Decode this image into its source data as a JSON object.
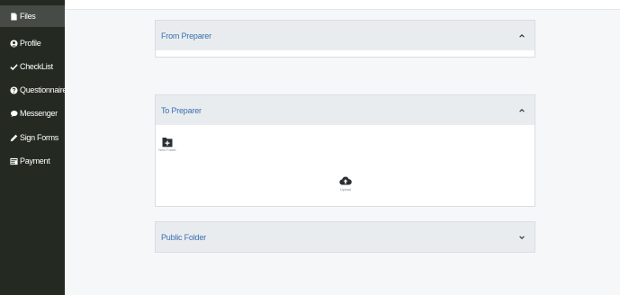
{
  "sidebar": {
    "items": [
      {
        "label": "Files",
        "icon": "file-icon"
      },
      {
        "label": "Profile",
        "icon": "user-icon"
      },
      {
        "label": "CheckList",
        "icon": "check-icon"
      },
      {
        "label": "Questionnaire",
        "icon": "question-icon"
      },
      {
        "label": "Messenger",
        "icon": "chat-icon"
      },
      {
        "label": "Sign Forms",
        "icon": "pen-icon"
      },
      {
        "label": "Payment",
        "icon": "payment-icon"
      }
    ]
  },
  "panels": {
    "from_preparer": {
      "title": "From Preparer",
      "expanded": true
    },
    "to_preparer": {
      "title": "To Preparer",
      "expanded": true,
      "new_folder_label": "New Folder",
      "upload_label": "Upload"
    },
    "public_folder": {
      "title": "Public Folder",
      "expanded": false
    }
  },
  "colors": {
    "sidebar_bg": "#242a22",
    "sidebar_active": "#474b45",
    "panel_header_bg": "#e9ecef",
    "panel_title": "#3a6fb0"
  }
}
